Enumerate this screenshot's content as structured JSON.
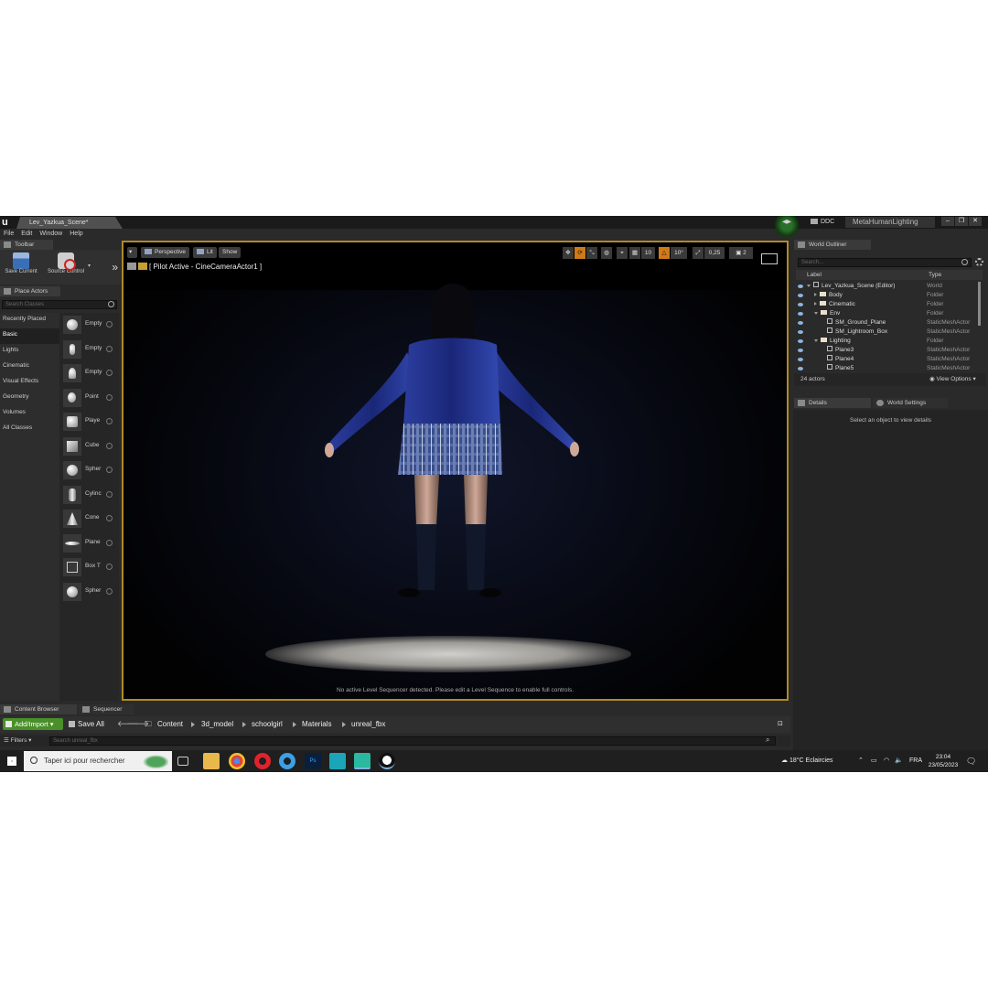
{
  "window": {
    "document_tab": "Lev_Yazkua_Scene*",
    "ddc_label": "DDC",
    "project_name": "MetaHumanLighting"
  },
  "menu": [
    "File",
    "Edit",
    "Window",
    "Help"
  ],
  "toolbar": {
    "tab_label": "Toolbar",
    "save_current": "Save Current",
    "source_control": "Source Control"
  },
  "place_actors": {
    "tab_label": "Place Actors",
    "search_placeholder": "Search Classes",
    "categories": [
      "Recently Placed",
      "Basic",
      "Lights",
      "Cinematic",
      "Visual Effects",
      "Geometry",
      "Volumes",
      "All Classes"
    ],
    "active_category": "Basic",
    "items": [
      "Empty",
      "Empty",
      "Empty",
      "Point",
      "Playe",
      "Cube",
      "Spher",
      "Cylinc",
      "Cone",
      "Plane",
      "Box T",
      "Spher"
    ]
  },
  "viewport": {
    "perspective": "Perspective",
    "lit": "Lit",
    "show": "Show",
    "pilot_text": "[ Pilot Active - CineCameraActor1 ]",
    "snap_grid": "10",
    "snap_angle": "10°",
    "snap_scale": "0,25",
    "camera_speed": "2",
    "sequencer_message": "No active Level Sequencer detected. Please edit a Level Sequence to enable full controls."
  },
  "world_outliner": {
    "tab_label": "World Outliner",
    "search_placeholder": "Search...",
    "col_label": "Label",
    "col_type": "Type",
    "rows": [
      {
        "label": "Lev_Yazkua_Scene (Editor)",
        "type": "World"
      },
      {
        "label": "Body",
        "type": "Folder"
      },
      {
        "label": "Cinematic",
        "type": "Folder"
      },
      {
        "label": "Env",
        "type": "Folder"
      },
      {
        "label": "SM_Ground_Plane",
        "type": "StaticMeshActor"
      },
      {
        "label": "SM_Lightroom_Box",
        "type": "StaticMeshActor"
      },
      {
        "label": "Lighting",
        "type": "Folder"
      },
      {
        "label": "Plane3",
        "type": "StaticMeshActor"
      },
      {
        "label": "Plane4",
        "type": "StaticMeshActor"
      },
      {
        "label": "Plane5",
        "type": "StaticMeshActor"
      }
    ],
    "actor_count": "24 actors",
    "view_options": "View Options"
  },
  "details": {
    "tab_label": "Details",
    "world_settings_tab": "World Settings",
    "empty_message": "Select an object to view details"
  },
  "content_browser": {
    "tab_label": "Content Browser",
    "sequencer_tab": "Sequencer",
    "add_import": "Add/Import",
    "save_all": "Save All",
    "breadcrumbs": [
      "Content",
      "3d_model",
      "schoolgirl",
      "Materials",
      "unreal_fbx"
    ],
    "filters": "Filters",
    "search_placeholder": "Search unreal_fbx"
  },
  "taskbar": {
    "search_placeholder": "Taper ici pour rechercher",
    "weather": "18°C  Eclaircies",
    "language": "FRA",
    "time": "23:04",
    "date": "23/05/2023"
  },
  "colors": {
    "viewport_border": "#b08a25",
    "add_import_green": "#4a8f2a",
    "snap_active_orange": "#d07a18",
    "skirt_blue": "#3b4f8a",
    "jacket_blue": "#1e2f8c"
  }
}
